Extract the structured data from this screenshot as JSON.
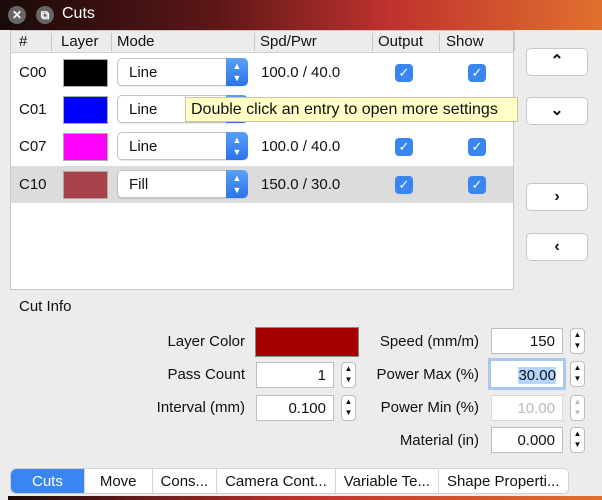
{
  "window": {
    "title": "Cuts",
    "close_icon": "close-icon",
    "restore_icon": "restore-icon"
  },
  "table": {
    "headers": [
      "#",
      "Layer",
      "Mode",
      "Spd/Pwr",
      "Output",
      "Show"
    ],
    "rows": [
      {
        "id": "C00",
        "color": "#000000",
        "mode": "Line",
        "spd_pwr": "100.0 / 40.0",
        "output": true,
        "show": true
      },
      {
        "id": "C01",
        "color": "#0000ff",
        "mode": "Line",
        "spd_pwr": "",
        "output": true,
        "show": true
      },
      {
        "id": "C07",
        "color": "#ff00ff",
        "mode": "Line",
        "spd_pwr": "100.0 / 40.0",
        "output": true,
        "show": true
      },
      {
        "id": "C10",
        "color": "#a8424a",
        "mode": "Fill",
        "spd_pwr": "150.0 / 30.0",
        "output": true,
        "show": true
      }
    ]
  },
  "tooltip": "Double click an entry to open more settings",
  "side_buttons": [
    "move-up",
    "move-down",
    "next",
    "previous"
  ],
  "cut_info": {
    "title": "Cut Info",
    "layer_color_label": "Layer Color",
    "layer_color": "#a80000",
    "pass_count_label": "Pass Count",
    "pass_count": "1",
    "interval_label": "Interval (mm)",
    "interval": "0.100",
    "speed_label": "Speed (mm/m)",
    "speed": "150",
    "power_max_label": "Power Max (%)",
    "power_max": "30.00",
    "power_min_label": "Power Min (%)",
    "power_min": "10.00",
    "material_label": "Material (in)",
    "material": "0.000"
  },
  "tabs": [
    "Cuts",
    "Move",
    "Cons...",
    "Camera Cont...",
    "Variable Te...",
    "Shape Properti..."
  ]
}
